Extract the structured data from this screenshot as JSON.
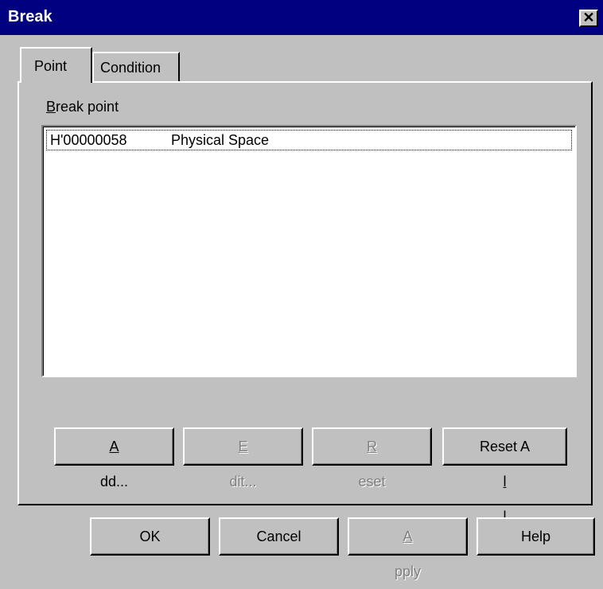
{
  "window": {
    "title": "Break",
    "close_glyph": "✕"
  },
  "tabs": [
    {
      "label": "Point",
      "selected": true
    },
    {
      "label": "Condition",
      "selected": false
    }
  ],
  "breakpoint_group": {
    "label_mnemonic": "B",
    "label_rest": "reak point",
    "rows": [
      {
        "address": "H'00000058",
        "space": "Physical Space"
      }
    ]
  },
  "list_buttons": {
    "add": {
      "mnemonic": "A",
      "rest": "dd...",
      "enabled": true
    },
    "edit": {
      "mnemonic": "E",
      "rest": "dit...",
      "enabled": false
    },
    "reset": {
      "mnemonic": "R",
      "rest": "eset",
      "enabled": false
    },
    "reset_all": {
      "before": "Reset A",
      "mnemonic": "l",
      "after": "l",
      "enabled": true
    }
  },
  "dialog_buttons": {
    "ok": {
      "label": "OK",
      "enabled": true
    },
    "cancel": {
      "label": "Cancel",
      "enabled": true
    },
    "apply": {
      "mnemonic": "A",
      "rest": "pply",
      "enabled": false
    },
    "help": {
      "label": "Help",
      "enabled": true
    }
  },
  "colors": {
    "face": "#c0c0c0",
    "title_bar": "#000080",
    "disabled_text": "#808080"
  }
}
